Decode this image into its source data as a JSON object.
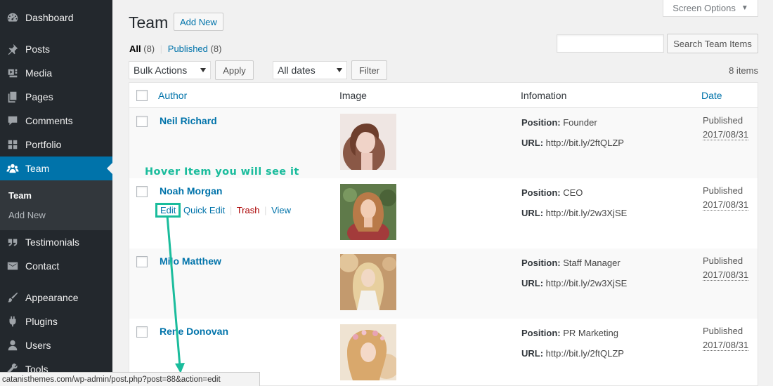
{
  "sidebar": {
    "items": [
      {
        "label": "Dashboard",
        "icon": "dashboard-icon"
      },
      {
        "label": "Posts",
        "icon": "pin-icon"
      },
      {
        "label": "Media",
        "icon": "media-icon"
      },
      {
        "label": "Pages",
        "icon": "pages-icon"
      },
      {
        "label": "Comments",
        "icon": "comment-icon"
      },
      {
        "label": "Portfolio",
        "icon": "grid-icon"
      },
      {
        "label": "Team",
        "icon": "team-icon"
      },
      {
        "label": "Testimonials",
        "icon": "quote-icon"
      },
      {
        "label": "Contact",
        "icon": "mail-icon"
      },
      {
        "label": "Appearance",
        "icon": "brush-icon"
      },
      {
        "label": "Plugins",
        "icon": "plugin-icon"
      },
      {
        "label": "Users",
        "icon": "user-icon"
      },
      {
        "label": "Tools",
        "icon": "wrench-icon"
      }
    ],
    "submenu": [
      "Team",
      "Add New"
    ]
  },
  "header": {
    "title": "Team",
    "add_new": "Add New",
    "screen_options": "Screen Options"
  },
  "views": {
    "all_label": "All",
    "all_count": "(8)",
    "separator": "|",
    "published_label": "Published",
    "published_count": "(8)"
  },
  "search": {
    "placeholder": "",
    "button": "Search Team Items"
  },
  "toolbar": {
    "bulk_actions": "Bulk Actions",
    "apply": "Apply",
    "dates": "All dates",
    "filter": "Filter",
    "items_count": "8 items"
  },
  "table": {
    "columns": {
      "author": "Author",
      "image": "Image",
      "info": "Infomation",
      "date": "Date"
    },
    "position_label": "Position:",
    "url_label": "URL:",
    "row_actions": {
      "edit": "Edit",
      "quick_edit": "Quick Edit",
      "trash": "Trash",
      "view": "View"
    },
    "rows": [
      {
        "name": "Neil Richard",
        "position": "Founder",
        "url": "http://bit.ly/2ftQLZP",
        "status": "Published",
        "date": "2017/08/31"
      },
      {
        "name": "Noah Morgan",
        "position": "CEO",
        "url": "http://bit.ly/2w3XjSE",
        "status": "Published",
        "date": "2017/08/31"
      },
      {
        "name": "Milo Matthew",
        "position": "Staff Manager",
        "url": "http://bit.ly/2w3XjSE",
        "status": "Published",
        "date": "2017/08/31"
      },
      {
        "name": "Rene Donovan",
        "position": "PR Marketing",
        "url": "http://bit.ly/2ftQLZP",
        "status": "Published",
        "date": "2017/08/31"
      }
    ]
  },
  "annotation": {
    "text": "Hover Item you will see it",
    "color": "#1abc9c"
  },
  "status_bar": {
    "url": "catanisthemes.com/wp-admin/post.php?post=88&action=edit"
  },
  "colors": {
    "sidebar_bg": "#23282d",
    "active_bg": "#0073aa",
    "link": "#0073aa",
    "trash": "#a00"
  }
}
